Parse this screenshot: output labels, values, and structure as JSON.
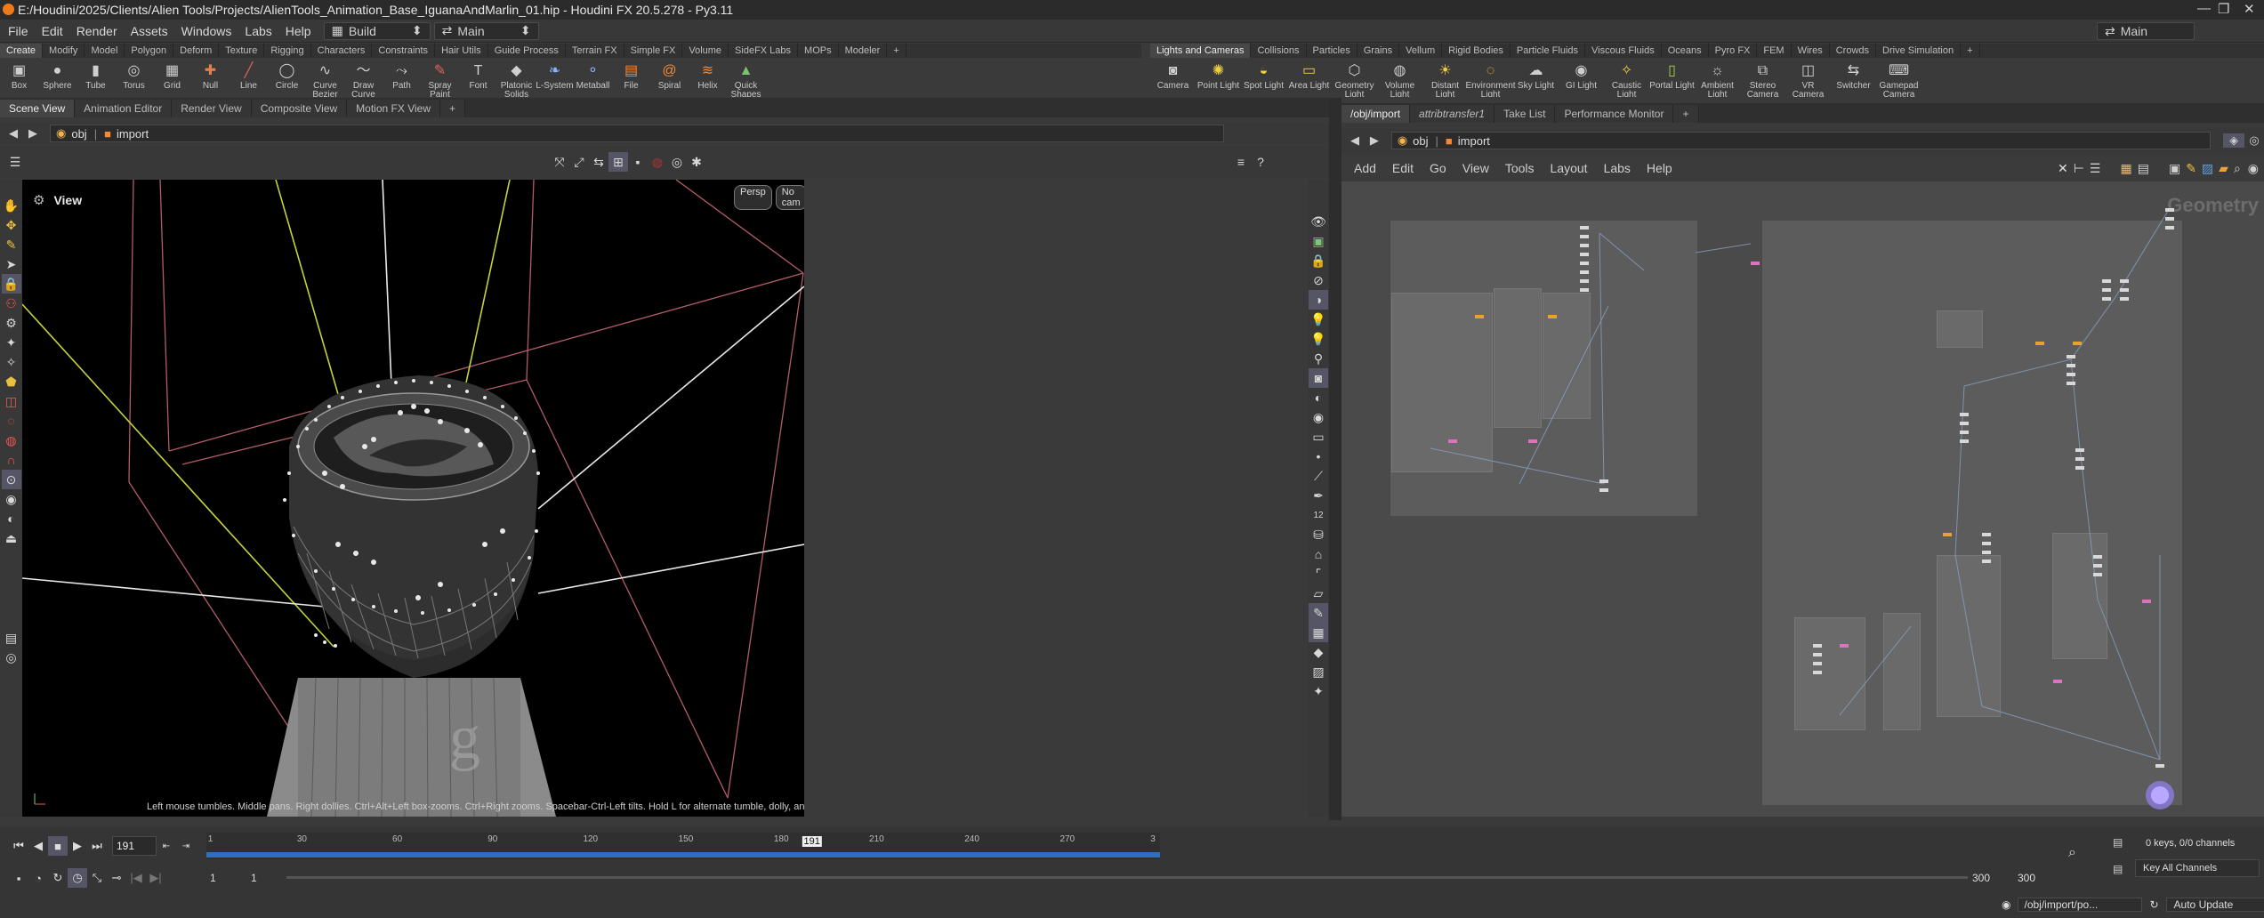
{
  "window": {
    "title": "E:/Houdini/2025/Clients/Alien Tools/Projects/AlienTools_Animation_Base_IguanaAndMarlin_01.hip - Houdini FX 20.5.278 - Py3.11"
  },
  "menubar": {
    "items": [
      "File",
      "Edit",
      "Render",
      "Assets",
      "Windows",
      "Labs",
      "Help"
    ],
    "desktop": "Build",
    "context": "Main",
    "right_context": "Main"
  },
  "shelf_left": {
    "tabs": [
      "Create",
      "Modify",
      "Model",
      "Polygon",
      "Deform",
      "Texture",
      "Rigging",
      "Characters",
      "Constraints",
      "Hair Utils",
      "Guide Process",
      "Terrain FX",
      "Simple FX",
      "Volume",
      "SideFX Labs",
      "MOPs",
      "Modeler"
    ],
    "tools": [
      {
        "label": "Box",
        "icon": "box-icon"
      },
      {
        "label": "Sphere",
        "icon": "sphere-icon"
      },
      {
        "label": "Tube",
        "icon": "tube-icon"
      },
      {
        "label": "Torus",
        "icon": "torus-icon"
      },
      {
        "label": "Grid",
        "icon": "grid-icon"
      },
      {
        "label": "Null",
        "icon": "null-icon"
      },
      {
        "label": "Line",
        "icon": "line-icon"
      },
      {
        "label": "Circle",
        "icon": "circle-icon"
      },
      {
        "label": "Curve Bezier",
        "icon": "curve-bezier-icon"
      },
      {
        "label": "Draw Curve",
        "icon": "draw-curve-icon"
      },
      {
        "label": "Path",
        "icon": "path-icon"
      },
      {
        "label": "Spray Paint",
        "icon": "spray-paint-icon"
      },
      {
        "label": "Font",
        "icon": "font-icon"
      },
      {
        "label": "Platonic Solids",
        "icon": "platonic-solids-icon"
      },
      {
        "label": "L-System",
        "icon": "l-system-icon"
      },
      {
        "label": "Metaball",
        "icon": "metaball-icon"
      },
      {
        "label": "File",
        "icon": "file-icon"
      },
      {
        "label": "Spiral",
        "icon": "spiral-icon"
      },
      {
        "label": "Helix",
        "icon": "helix-icon"
      },
      {
        "label": "Quick Shapes",
        "icon": "quick-shapes-icon"
      }
    ]
  },
  "shelf_right": {
    "tabs": [
      "Lights and Cameras",
      "Collisions",
      "Particles",
      "Grains",
      "Vellum",
      "Rigid Bodies",
      "Particle Fluids",
      "Viscous Fluids",
      "Oceans",
      "Pyro FX",
      "FEM",
      "Wires",
      "Crowds",
      "Drive Simulation"
    ],
    "tools": [
      {
        "label": "Camera",
        "icon": "camera-icon"
      },
      {
        "label": "Point Light",
        "icon": "point-light-icon"
      },
      {
        "label": "Spot Light",
        "icon": "spot-light-icon"
      },
      {
        "label": "Area Light",
        "icon": "area-light-icon"
      },
      {
        "label": "Geometry Light",
        "icon": "geometry-light-icon"
      },
      {
        "label": "Volume Light",
        "icon": "volume-light-icon"
      },
      {
        "label": "Distant Light",
        "icon": "distant-light-icon"
      },
      {
        "label": "Environment Light",
        "icon": "environment-light-icon"
      },
      {
        "label": "Sky Light",
        "icon": "sky-light-icon"
      },
      {
        "label": "GI Light",
        "icon": "gi-light-icon"
      },
      {
        "label": "Caustic Light",
        "icon": "caustic-light-icon"
      },
      {
        "label": "Portal Light",
        "icon": "portal-light-icon"
      },
      {
        "label": "Ambient Light",
        "icon": "ambient-light-icon"
      },
      {
        "label": "Stereo Camera",
        "icon": "stereo-camera-icon"
      },
      {
        "label": "VR Camera",
        "icon": "vr-camera-icon"
      },
      {
        "label": "Switcher",
        "icon": "switcher-icon"
      },
      {
        "label": "Gamepad Camera",
        "icon": "gamepad-camera-icon"
      }
    ]
  },
  "left_pane": {
    "tabs": [
      "Scene View",
      "Animation Editor",
      "Render View",
      "Composite View",
      "Motion FX View"
    ],
    "path": [
      "obj",
      "import"
    ],
    "viewport_title": "View",
    "persp_label": "Persp",
    "cam_label": "No cam",
    "status_hint": "Left mouse tumbles. Middle pans. Right dollies. Ctrl+Alt+Left box-zooms. Ctrl+Right zooms. Spacebar-Ctrl-Left tilts. Hold L for alternate tumble, dolly, and zoom.  M or Alt+M for First Person Navigation.",
    "side_value": "12"
  },
  "right_pane": {
    "tabs": [
      "/obj/import",
      "attribtransfer1",
      "Take List",
      "Performance Monitor"
    ],
    "path": [
      "obj",
      "import"
    ],
    "menu": [
      "Add",
      "Edit",
      "Go",
      "View",
      "Tools",
      "Layout",
      "Labs",
      "Help"
    ],
    "net_label": "Geometry"
  },
  "timeline": {
    "current_frame": "191",
    "ticks": [
      "1",
      "30",
      "60",
      "90",
      "120",
      "150",
      "180",
      "210",
      "240",
      "270",
      "3"
    ],
    "current_marker": "191",
    "current_fraction": 0.635,
    "start_a": "1",
    "start_b": "1",
    "end_a": "300",
    "end_b": "300",
    "keys_label": "0 keys, 0/0 channels",
    "key_all_label": "Key All Channels",
    "status_path": "/obj/import/po...",
    "auto_update": "Auto Update"
  },
  "colors": {
    "accent": "#f07a1a",
    "timeline_bar": "#2f6fc1",
    "viewport_bg": "#000000"
  }
}
